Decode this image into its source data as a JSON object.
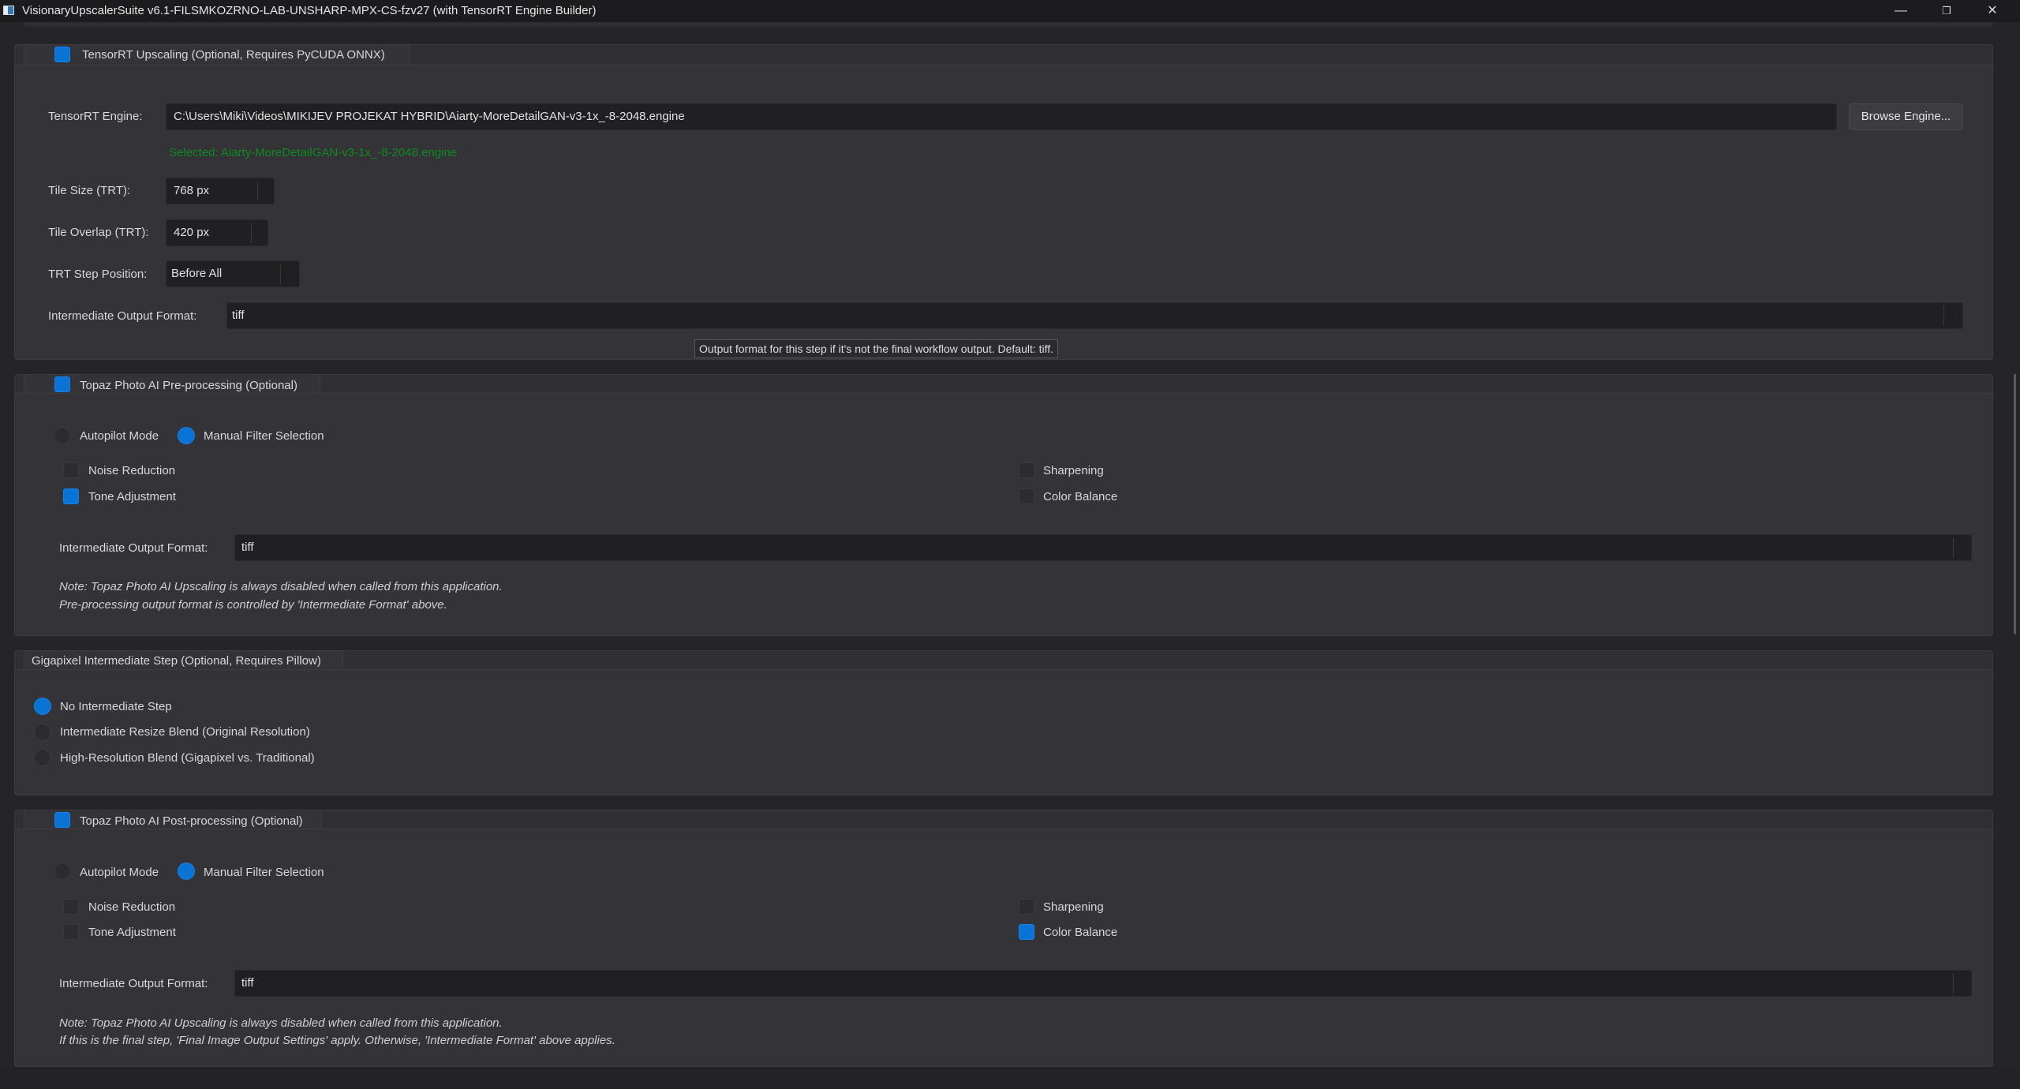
{
  "window": {
    "title": "VisionaryUpscalerSuite v6.1-FILSMKOZRNO-LAB-UNSHARP-MPX-CS-fzv27 (with TensorRT Engine Builder)",
    "minimize": "—",
    "restore": "❐",
    "close": "✕"
  },
  "tensorrt": {
    "checkbox_label": "TensorRT Upscaling (Optional, Requires PyCUDA  ONNX)",
    "checked": true,
    "engine_label": "TensorRT Engine:",
    "engine_path": "C:\\Users\\Miki\\Videos\\MIKIJEV PROJEKAT HYBRID\\Aiarty-MoreDetailGAN-v3-1x_-8-2048.engine",
    "browse_label": "Browse Engine...",
    "selected_status": "Selected: Aiarty-MoreDetailGAN-v3-1x_-8-2048.engine",
    "tile_size_label": "Tile Size (TRT):",
    "tile_size_value": "768 px",
    "tile_overlap_label": "Tile Overlap (TRT):",
    "tile_overlap_value": "420 px",
    "step_position_label": "TRT Step Position:",
    "step_position_value": "Before All",
    "output_format_label": "Intermediate Output Format:",
    "output_format_value": "tiff",
    "tooltip": "Output format for this step if it's not the final workflow output. Default: tiff."
  },
  "pre": {
    "checkbox_label": "Topaz Photo AI Pre-processing (Optional)",
    "checked": true,
    "autopilot_label": "Autopilot Mode",
    "manual_label": "Manual Filter Selection",
    "mode": "manual",
    "noise_label": "Noise Reduction",
    "sharpen_label": "Sharpening",
    "tone_label": "Tone Adjustment",
    "color_label": "Color Balance",
    "output_format_label": "Intermediate Output Format:",
    "output_format_value": "tiff",
    "note1": "Note: Topaz Photo AI Upscaling is always disabled when called from this application.",
    "note2": "Pre-processing output format is controlled by 'Intermediate Format' above."
  },
  "giga": {
    "title": "Gigapixel Intermediate Step (Optional, Requires Pillow)",
    "opt1": "No Intermediate Step",
    "opt2": "Intermediate Resize  Blend (Original Resolution)",
    "opt3": "High-Resolution Blend (Gigapixel vs. Traditional)",
    "selected": "No Intermediate Step"
  },
  "post": {
    "checkbox_label": "Topaz Photo AI Post-processing (Optional)",
    "checked": true,
    "autopilot_label": "Autopilot Mode",
    "manual_label": "Manual Filter Selection",
    "mode": "manual",
    "noise_label": "Noise Reduction",
    "sharpen_label": "Sharpening",
    "tone_label": "Tone Adjustment",
    "color_label": "Color Balance",
    "output_format_label": "Intermediate Output Format:",
    "output_format_value": "tiff",
    "note1": "Note: Topaz Photo AI Upscaling is always disabled when called from this application.",
    "note2": "If this is the final step, 'Final Image Output Settings' apply. Otherwise, 'Intermediate Format' above applies."
  },
  "colors": {
    "accent": "#0a73d6",
    "background": "#252529",
    "status_green": "#0f8a1e"
  }
}
